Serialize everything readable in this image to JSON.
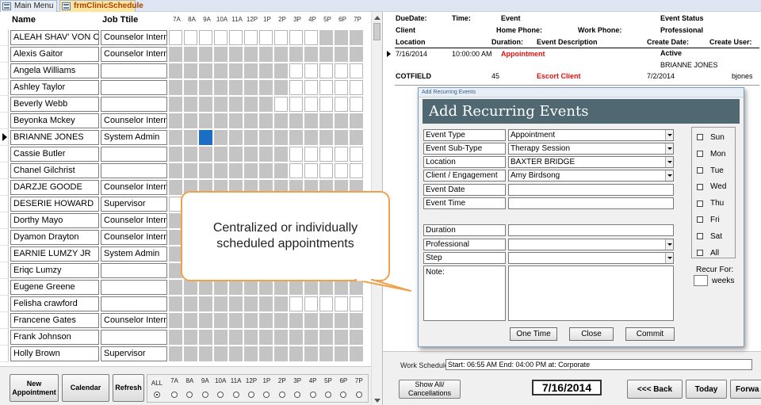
{
  "tabs": [
    {
      "label": "Main Menu"
    },
    {
      "label": "frmClinicSchedule"
    }
  ],
  "schedule": {
    "header_name": "Name",
    "header_job": "Job Ttile",
    "hours": [
      "7A",
      "8A",
      "9A",
      "10A",
      "11A",
      "12P",
      "1P",
      "2P",
      "3P",
      "4P",
      "5P",
      "6P",
      "7P"
    ],
    "rows": [
      {
        "name": "ALEAH SHAV' VON CLA",
        "job": "Counselor Intern",
        "slots": "0000000000111",
        "current": false
      },
      {
        "name": "Alexis Gaitor",
        "job": "Counselor Intern",
        "slots": "1111111111111",
        "current": false
      },
      {
        "name": "Angela Williams",
        "job": "",
        "slots": "1111111100000",
        "current": false
      },
      {
        "name": "Ashley Taylor",
        "job": "",
        "slots": "1111111100000",
        "current": false
      },
      {
        "name": "Beverly Webb",
        "job": "",
        "slots": "1111111000000",
        "current": false
      },
      {
        "name": "Beyonka Mckey",
        "job": "Counselor Intern",
        "slots": "1111111111111",
        "current": false
      },
      {
        "name": "BRIANNE JONES",
        "job": "System Admin",
        "slots": "1121111111111",
        "current": true
      },
      {
        "name": "Cassie Butler",
        "job": "",
        "slots": "1111111100000",
        "current": false
      },
      {
        "name": "Chanel Gilchrist",
        "job": "",
        "slots": "1111111100000",
        "current": false
      },
      {
        "name": "DARZJE GOODE",
        "job": "Counselor Intern",
        "slots": "1111111111111",
        "current": false
      },
      {
        "name": "DESERIE HOWARD",
        "job": "Supervisor",
        "slots": "0000000000000",
        "current": false
      },
      {
        "name": "Dorthy Mayo",
        "job": "Counselor Intern",
        "slots": "1111111111111",
        "current": false
      },
      {
        "name": "Dyamon Drayton",
        "job": "Counselor Intern",
        "slots": "1111111111111",
        "current": false
      },
      {
        "name": "EARNIE LUMZY JR",
        "job": "System Admin",
        "slots": "1111111111111",
        "current": false
      },
      {
        "name": "Eriqc Lumzy",
        "job": "",
        "slots": "1111111111111",
        "current": false
      },
      {
        "name": "Eugene Greene",
        "job": "",
        "slots": "1111111111111",
        "current": false
      },
      {
        "name": "Felisha crawford",
        "job": "",
        "slots": "1111111100000",
        "current": false
      },
      {
        "name": "Francene Gates",
        "job": "Counselor Intern",
        "slots": "1111111111111",
        "current": false
      },
      {
        "name": "Frank Johnson",
        "job": "",
        "slots": "1111111111111",
        "current": false
      },
      {
        "name": "Holly Brown",
        "job": "Supervisor",
        "slots": "1111111111111",
        "current": false
      }
    ]
  },
  "footer": {
    "new_appointment": "New Appointment",
    "calendar": "Calendar",
    "refresh": "Refresh",
    "all_label": "ALL",
    "selected_radio": "ALL"
  },
  "callout_text": "Centralized or individually scheduled appointments",
  "events": {
    "headers": {
      "due_date": "DueDate:",
      "time": "Time:",
      "event": "Event",
      "event_status": "Event Status",
      "client": "Client",
      "home_phone": "Home Phone:",
      "work_phone": "Work Phone:",
      "professional": "Professional",
      "location": "Location",
      "duration": "Duration:",
      "event_description": "Event Description",
      "create_date": "Create Date:",
      "create_user": "Create User:"
    },
    "record": {
      "due_date": "7/16/2014",
      "time": "10:00:00 AM",
      "event": "Appointment",
      "status": "Active",
      "professional": "BRIANNE JONES",
      "location": "COTFIELD",
      "duration": "45",
      "description": "Escort Client",
      "create_date": "7/2/2014",
      "create_user": "bjones"
    }
  },
  "dialog": {
    "titlebar": "Add Recurring Events",
    "header": "Add Recurring Events",
    "fields": [
      {
        "label": "Event Type",
        "value": "Appointment",
        "dropdown": true
      },
      {
        "label": "Event Sub-Type",
        "value": "Therapy Session",
        "dropdown": true
      },
      {
        "label": "Location",
        "value": "BAXTER BRIDGE",
        "dropdown": true
      },
      {
        "label": "Client / Engagement",
        "value": "Amy Birdsong",
        "dropdown": true
      },
      {
        "label": "Event Date",
        "value": "",
        "dropdown": false
      },
      {
        "label": "Event Time",
        "value": "",
        "dropdown": false
      },
      {
        "label": "Duration",
        "value": "",
        "dropdown": false
      },
      {
        "label": "Professional",
        "value": "",
        "dropdown": true
      },
      {
        "label": "Step",
        "value": "",
        "dropdown": true
      }
    ],
    "note_label": "Note:",
    "days": [
      "Sun",
      "Mon",
      "Tue",
      "Wed",
      "Thu",
      "Fri",
      "Sat",
      "All"
    ],
    "recur_for": "Recur For:",
    "weeks": "weeks",
    "buttons": {
      "one_time": "One Time",
      "close": "Close",
      "commit": "Commit"
    }
  },
  "right_footer": {
    "work_schedule_label": "Work Schedule",
    "work_schedule_value": "Start: 06:55 AM  End: 04:00 PM  at: Corporate",
    "show_all": "Show All/ Cancellations",
    "date": "7/16/2014",
    "back": "<<< Back",
    "today": "Today",
    "forward": "Forwa"
  },
  "colors": {
    "busy_slot": "#c4c4c4",
    "current_slot": "#1a6fc4",
    "dialog_header": "#4f6872",
    "callout_border": "#f0a24a",
    "event_red": "#e01010"
  }
}
